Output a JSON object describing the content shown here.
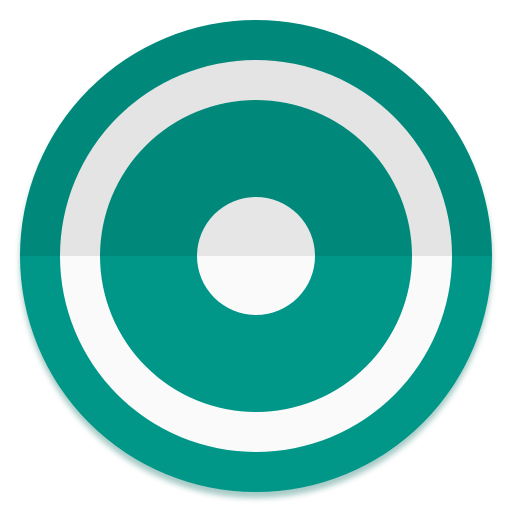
{
  "icon": {
    "name": "record-icon",
    "colors": {
      "teal_top": "#00897B",
      "teal_bottom": "#009688",
      "ring_top": "#E4E4E4",
      "ring_bottom": "#FAFAFA",
      "dot_top": "#E6E6E6",
      "dot_bottom": "#FAFAFA",
      "shadow": "#00695C"
    }
  }
}
